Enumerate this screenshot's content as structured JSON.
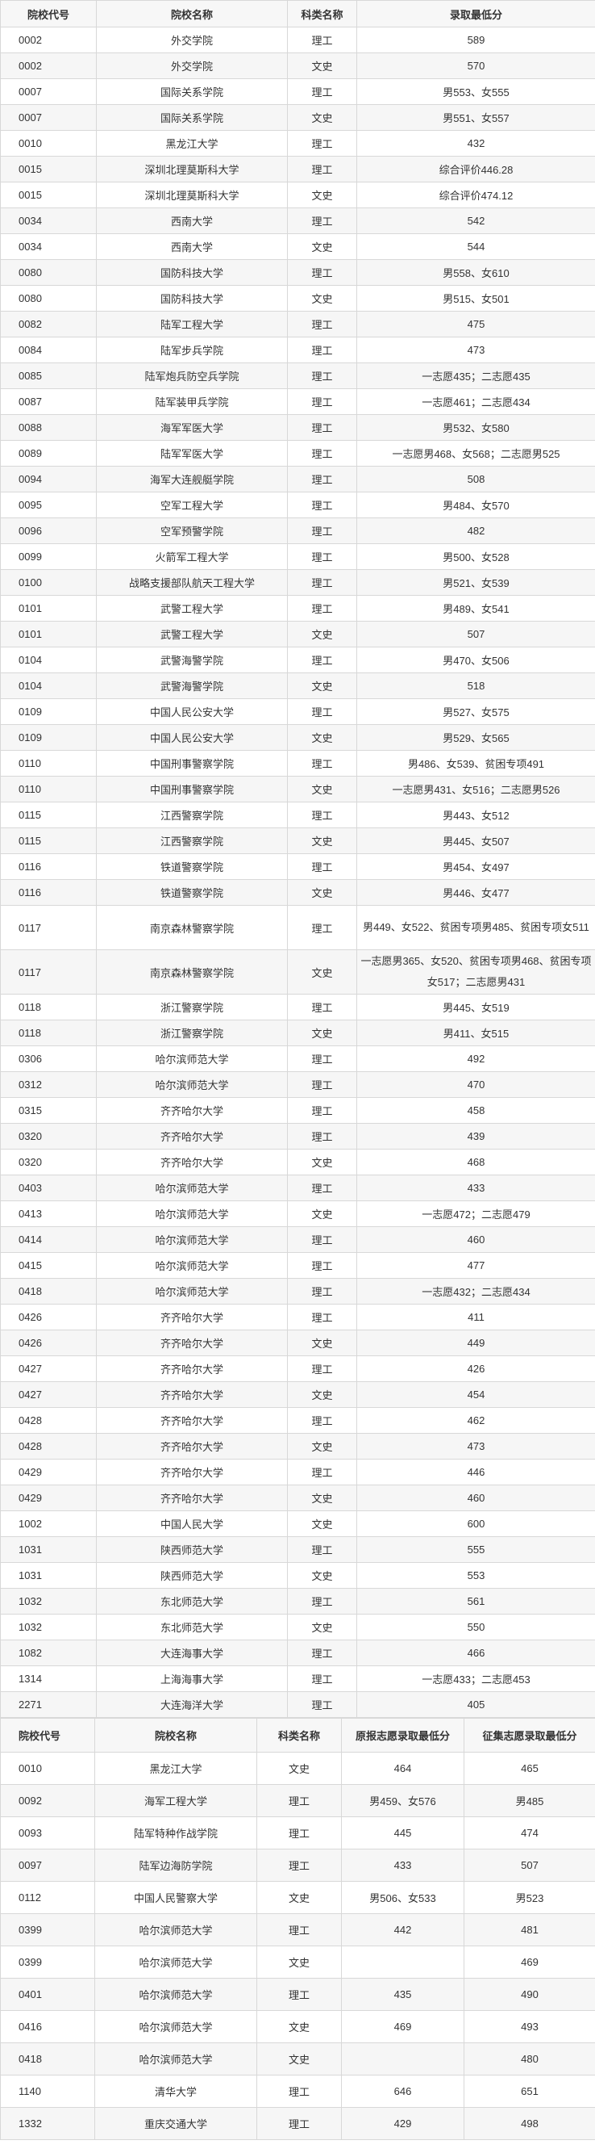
{
  "table1": {
    "headers": [
      "院校代号",
      "院校名称",
      "科类名称",
      "录取最低分"
    ],
    "rows": [
      [
        "0002",
        "外交学院",
        "理工",
        "589"
      ],
      [
        "0002",
        "外交学院",
        "文史",
        "570"
      ],
      [
        "0007",
        "国际关系学院",
        "理工",
        "男553、女555"
      ],
      [
        "0007",
        "国际关系学院",
        "文史",
        "男551、女557"
      ],
      [
        "0010",
        "黑龙江大学",
        "理工",
        "432"
      ],
      [
        "0015",
        "深圳北理莫斯科大学",
        "理工",
        "综合评价446.28"
      ],
      [
        "0015",
        "深圳北理莫斯科大学",
        "文史",
        "综合评价474.12"
      ],
      [
        "0034",
        "西南大学",
        "理工",
        "542"
      ],
      [
        "0034",
        "西南大学",
        "文史",
        "544"
      ],
      [
        "0080",
        "国防科技大学",
        "理工",
        "男558、女610"
      ],
      [
        "0080",
        "国防科技大学",
        "文史",
        "男515、女501"
      ],
      [
        "0082",
        "陆军工程大学",
        "理工",
        "475"
      ],
      [
        "0084",
        "陆军步兵学院",
        "理工",
        "473"
      ],
      [
        "0085",
        "陆军炮兵防空兵学院",
        "理工",
        "一志愿435；二志愿435"
      ],
      [
        "0087",
        "陆军装甲兵学院",
        "理工",
        "一志愿461；二志愿434"
      ],
      [
        "0088",
        "海军军医大学",
        "理工",
        "男532、女580"
      ],
      [
        "0089",
        "陆军军医大学",
        "理工",
        "一志愿男468、女568；二志愿男525"
      ],
      [
        "0094",
        "海军大连舰艇学院",
        "理工",
        "508"
      ],
      [
        "0095",
        "空军工程大学",
        "理工",
        "男484、女570"
      ],
      [
        "0096",
        "空军预警学院",
        "理工",
        "482"
      ],
      [
        "0099",
        "火箭军工程大学",
        "理工",
        "男500、女528"
      ],
      [
        "0100",
        "战略支援部队航天工程大学",
        "理工",
        "男521、女539"
      ],
      [
        "0101",
        "武警工程大学",
        "理工",
        "男489、女541"
      ],
      [
        "0101",
        "武警工程大学",
        "文史",
        "507"
      ],
      [
        "0104",
        "武警海警学院",
        "理工",
        "男470、女506"
      ],
      [
        "0104",
        "武警海警学院",
        "文史",
        "518"
      ],
      [
        "0109",
        "中国人民公安大学",
        "理工",
        "男527、女575"
      ],
      [
        "0109",
        "中国人民公安大学",
        "文史",
        "男529、女565"
      ],
      [
        "0110",
        "中国刑事警察学院",
        "理工",
        "男486、女539、贫困专项491"
      ],
      [
        "0110",
        "中国刑事警察学院",
        "文史",
        "一志愿男431、女516；二志愿男526"
      ],
      [
        "0115",
        "江西警察学院",
        "理工",
        "男443、女512"
      ],
      [
        "0115",
        "江西警察学院",
        "文史",
        "男445、女507"
      ],
      [
        "0116",
        "铁道警察学院",
        "理工",
        "男454、女497"
      ],
      [
        "0116",
        "铁道警察学院",
        "文史",
        "男446、女477"
      ],
      [
        "0117",
        "南京森林警察学院",
        "理工",
        "男449、女522、贫困专项男485、贫困专项女511"
      ],
      [
        "0117",
        "南京森林警察学院",
        "文史",
        "一志愿男365、女520、贫困专项男468、贫困专项女517；二志愿男431"
      ],
      [
        "0118",
        "浙江警察学院",
        "理工",
        "男445、女519"
      ],
      [
        "0118",
        "浙江警察学院",
        "文史",
        "男411、女515"
      ],
      [
        "0306",
        "哈尔滨师范大学",
        "理工",
        "492"
      ],
      [
        "0312",
        "哈尔滨师范大学",
        "理工",
        "470"
      ],
      [
        "0315",
        "齐齐哈尔大学",
        "理工",
        "458"
      ],
      [
        "0320",
        "齐齐哈尔大学",
        "理工",
        "439"
      ],
      [
        "0320",
        "齐齐哈尔大学",
        "文史",
        "468"
      ],
      [
        "0403",
        "哈尔滨师范大学",
        "理工",
        "433"
      ],
      [
        "0413",
        "哈尔滨师范大学",
        "文史",
        "一志愿472；二志愿479"
      ],
      [
        "0414",
        "哈尔滨师范大学",
        "理工",
        "460"
      ],
      [
        "0415",
        "哈尔滨师范大学",
        "理工",
        "477"
      ],
      [
        "0418",
        "哈尔滨师范大学",
        "理工",
        "一志愿432；二志愿434"
      ],
      [
        "0426",
        "齐齐哈尔大学",
        "理工",
        "411"
      ],
      [
        "0426",
        "齐齐哈尔大学",
        "文史",
        "449"
      ],
      [
        "0427",
        "齐齐哈尔大学",
        "理工",
        "426"
      ],
      [
        "0427",
        "齐齐哈尔大学",
        "文史",
        "454"
      ],
      [
        "0428",
        "齐齐哈尔大学",
        "理工",
        "462"
      ],
      [
        "0428",
        "齐齐哈尔大学",
        "文史",
        "473"
      ],
      [
        "0429",
        "齐齐哈尔大学",
        "理工",
        "446"
      ],
      [
        "0429",
        "齐齐哈尔大学",
        "文史",
        "460"
      ],
      [
        "1002",
        "中国人民大学",
        "文史",
        "600"
      ],
      [
        "1031",
        "陕西师范大学",
        "理工",
        "555"
      ],
      [
        "1031",
        "陕西师范大学",
        "文史",
        "553"
      ],
      [
        "1032",
        "东北师范大学",
        "理工",
        "561"
      ],
      [
        "1032",
        "东北师范大学",
        "文史",
        "550"
      ],
      [
        "1082",
        "大连海事大学",
        "理工",
        "466"
      ],
      [
        "1314",
        "上海海事大学",
        "理工",
        "一志愿433；二志愿453"
      ],
      [
        "2271",
        "大连海洋大学",
        "理工",
        "405"
      ]
    ]
  },
  "table2": {
    "headers": [
      "院校代号",
      "院校名称",
      "科类名称",
      "原报志愿录取最低分",
      "征集志愿录取最低分"
    ],
    "rows": [
      [
        "0010",
        "黑龙江大学",
        "文史",
        "464",
        "465"
      ],
      [
        "0092",
        "海军工程大学",
        "理工",
        "男459、女576",
        "男485"
      ],
      [
        "0093",
        "陆军特种作战学院",
        "理工",
        "445",
        "474"
      ],
      [
        "0097",
        "陆军边海防学院",
        "理工",
        "433",
        "507"
      ],
      [
        "0112",
        "中国人民警察大学",
        "文史",
        "男506、女533",
        "男523"
      ],
      [
        "0399",
        "哈尔滨师范大学",
        "理工",
        "442",
        "481"
      ],
      [
        "0399",
        "哈尔滨师范大学",
        "文史",
        "",
        "469"
      ],
      [
        "0401",
        "哈尔滨师范大学",
        "理工",
        "435",
        "490"
      ],
      [
        "0416",
        "哈尔滨师范大学",
        "文史",
        "469",
        "493"
      ],
      [
        "0418",
        "哈尔滨师范大学",
        "文史",
        "",
        "480"
      ],
      [
        "1140",
        "清华大学",
        "理工",
        "646",
        "651"
      ],
      [
        "1332",
        "重庆交通大学",
        "理工",
        "429",
        "498"
      ]
    ]
  }
}
